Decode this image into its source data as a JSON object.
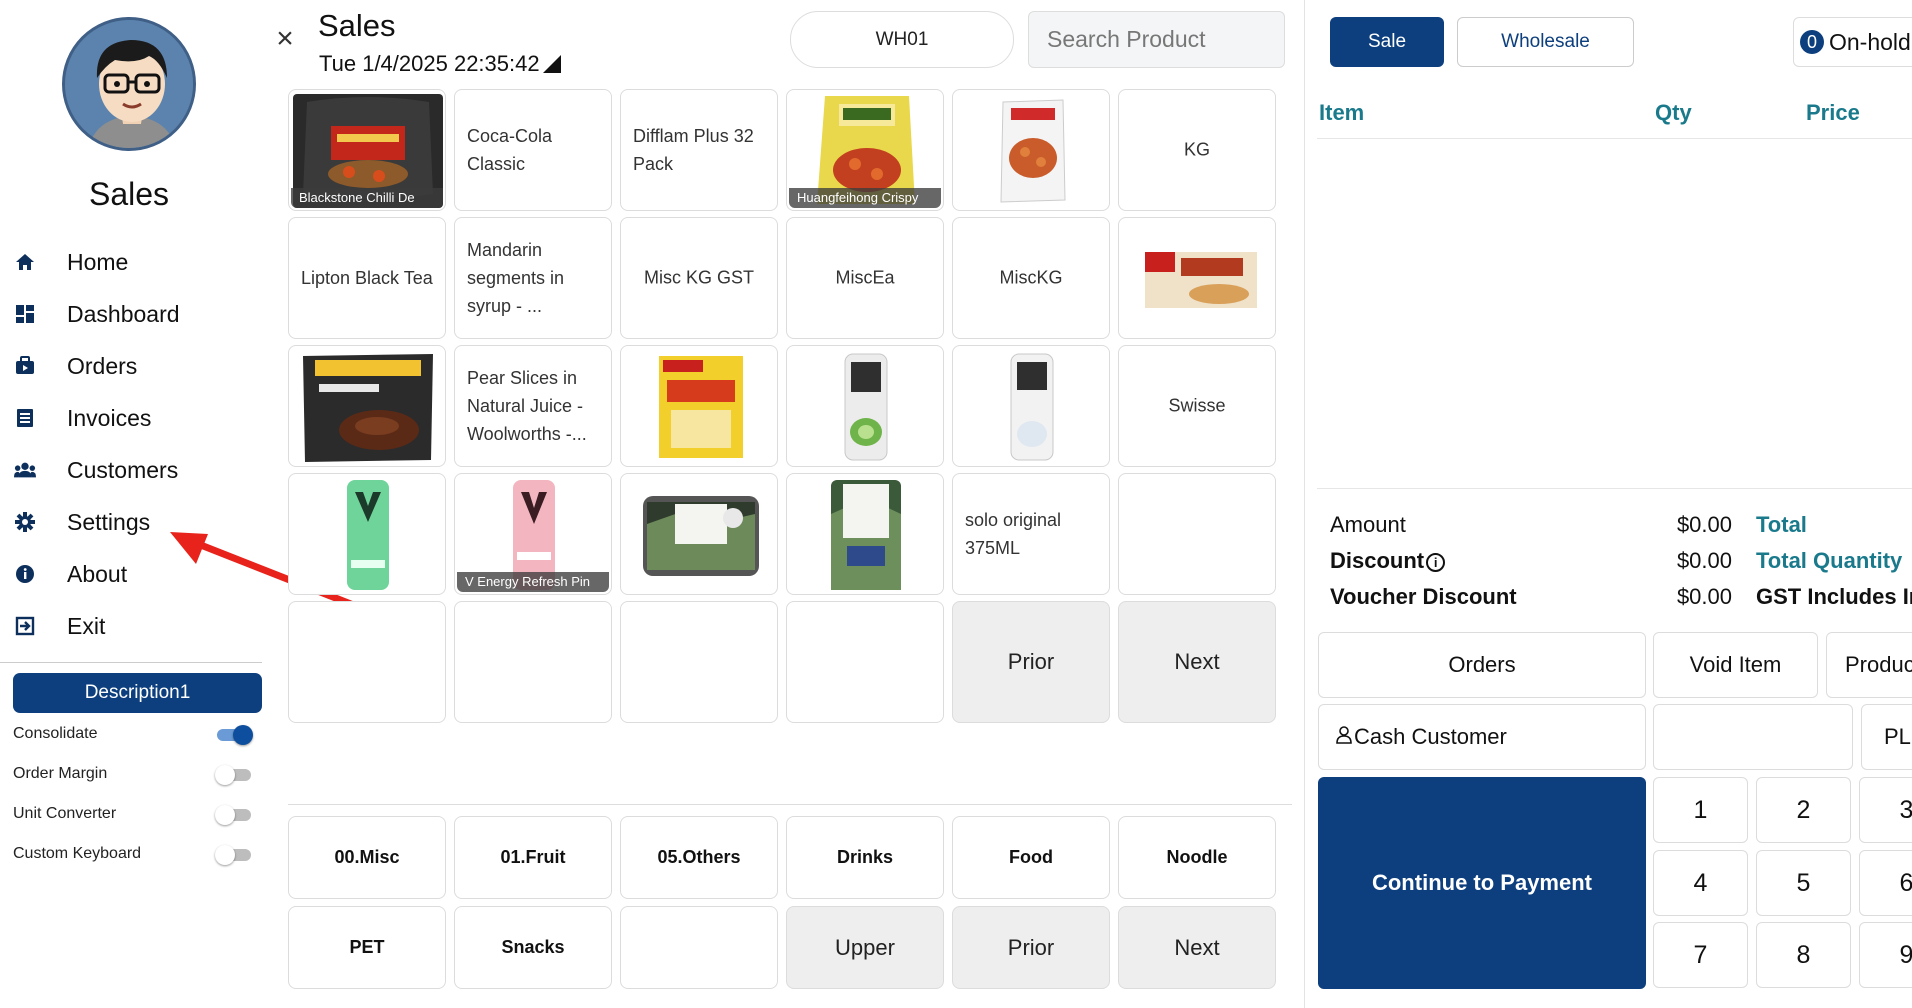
{
  "sidebar": {
    "title": "Sales",
    "nav": [
      {
        "label": "Home",
        "icon": "home-icon"
      },
      {
        "label": "Dashboard",
        "icon": "dashboard-icon"
      },
      {
        "label": "Orders",
        "icon": "orders-icon"
      },
      {
        "label": "Invoices",
        "icon": "invoices-icon"
      },
      {
        "label": "Customers",
        "icon": "customers-icon"
      },
      {
        "label": "Settings",
        "icon": "gear-icon"
      },
      {
        "label": "About",
        "icon": "info-icon"
      },
      {
        "label": "Exit",
        "icon": "exit-icon"
      }
    ],
    "description_button": "Description1",
    "toggles": [
      {
        "label": "Consolidate",
        "on": true
      },
      {
        "label": "Order Margin",
        "on": false
      },
      {
        "label": "Unit Converter",
        "on": false
      },
      {
        "label": "Custom Keyboard",
        "on": false
      }
    ]
  },
  "header": {
    "title": "Sales",
    "datetime": "Tue 1/4/2025 22:35:42",
    "warehouse": "WH01",
    "search_placeholder": "Search Product"
  },
  "products": {
    "tiles": [
      {
        "caption": "Blackstone Chilli De"
      },
      {
        "label": "Coca-Cola Classic"
      },
      {
        "label": "Difflam Plus 32 Pack"
      },
      {
        "caption": "Huangfeihong Crispy"
      },
      {
        "caption": ""
      },
      {
        "label": "KG"
      },
      {
        "label": "Lipton Black Tea"
      },
      {
        "label": "Mandarin segments in syrup - ..."
      },
      {
        "label": "Misc KG GST"
      },
      {
        "label": "MiscEa"
      },
      {
        "label": "MiscKG"
      },
      {
        "caption": ""
      },
      {
        "caption": ""
      },
      {
        "label": "Pear Slices in Natural Juice - Woolworths -..."
      },
      {
        "caption": ""
      },
      {
        "caption": ""
      },
      {
        "caption": ""
      },
      {
        "label": "Swisse"
      },
      {
        "caption": ""
      },
      {
        "caption": "V Energy Refresh Pin"
      },
      {
        "caption": ""
      },
      {
        "caption": ""
      },
      {
        "label": "solo original 375ML"
      },
      {
        "label": ""
      }
    ],
    "prior_label": "Prior",
    "next_label": "Next"
  },
  "categories": {
    "items": [
      "00.Misc",
      "01.Fruit",
      "05.Others",
      "Drinks",
      "Food",
      "Noodle",
      "PET",
      "Snacks"
    ],
    "upper_label": "Upper",
    "prior_label": "Prior",
    "next_label": "Next"
  },
  "cart": {
    "sale_label": "Sale",
    "wholesale_label": "Wholesale",
    "onhold_count": "0",
    "onhold_label": "On-hold",
    "col_item": "Item",
    "col_qty": "Qty",
    "col_price": "Price",
    "amount_label": "Amount",
    "amount_value": "$0.00",
    "discount_label": "Discount",
    "discount_value": "$0.00",
    "voucher_label": "Voucher Discount",
    "voucher_value": "$0.00",
    "total_label": "Total",
    "total_qty_label": "Total Quantity",
    "gst_label": "GST Includes In"
  },
  "actions": {
    "orders": "Orders",
    "void_item": "Void Item",
    "product": "Produc",
    "customer": "Cash Customer",
    "pl": "PL",
    "continue": "Continue to Payment"
  },
  "keypad": [
    "1",
    "2",
    "3",
    "4",
    "5",
    "6",
    "7",
    "8",
    "9"
  ],
  "colors": {
    "primary": "#0d3f7e",
    "accent_text": "#1a7a8c",
    "annotation": "#e8231c"
  }
}
